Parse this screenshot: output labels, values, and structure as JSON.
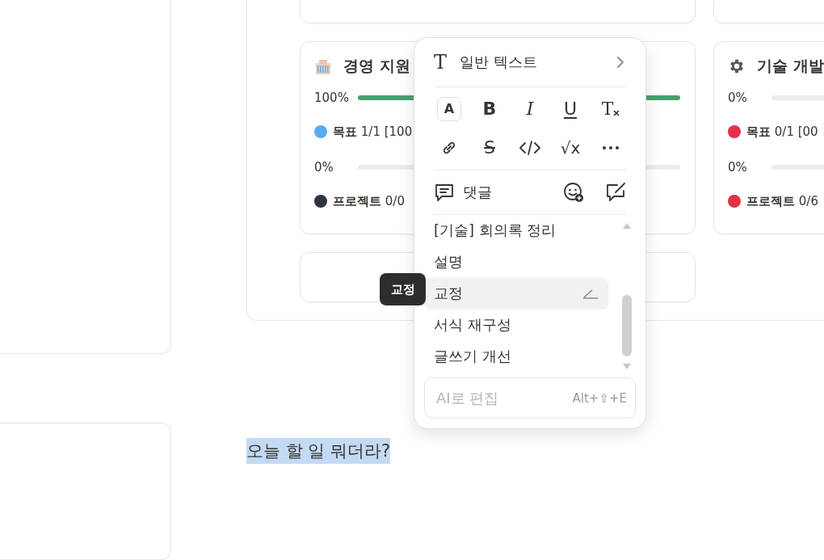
{
  "board": {
    "cards": [
      {
        "kind": "blank"
      },
      {
        "kind": "blank"
      },
      {
        "kind": "building",
        "title": "경영 지원",
        "rows": [
          {
            "kind": "progress",
            "reading": "100%",
            "level": 1
          },
          {
            "kind": "count",
            "label": "목표",
            "value": "1/1 [100",
            "color": "#5aabf0"
          },
          {
            "kind": "progress",
            "reading": "0%",
            "level": 0
          },
          {
            "kind": "count",
            "label": "프로젝트",
            "value": "0/0",
            "color": "#2e3440"
          }
        ]
      },
      {
        "kind": "gear",
        "title": "기술 개발",
        "rows": [
          {
            "kind": "progress",
            "reading": "0%",
            "level": 0
          },
          {
            "kind": "count",
            "label": "목표",
            "value": "0/1 [00",
            "color": "#e0334a"
          },
          {
            "kind": "progress",
            "reading": "0%",
            "level": 0
          },
          {
            "kind": "count",
            "label": "프로젝트",
            "value": "0/6",
            "color": "#e0334a"
          }
        ]
      },
      {
        "kind": "blank"
      }
    ]
  },
  "selected_text": "오늘 할 일 뭐더라?",
  "popup": {
    "block_type": {
      "icon_label": "T",
      "label": "일반 텍스트"
    },
    "format_buttons": [
      {
        "kind": "color",
        "label": "A"
      },
      {
        "kind": "bold",
        "label": "B"
      },
      {
        "kind": "italic",
        "label": "I"
      },
      {
        "kind": "underline",
        "label": "U"
      },
      {
        "kind": "clear",
        "label": "T"
      },
      {
        "kind": "link"
      },
      {
        "kind": "strike",
        "label": "S"
      },
      {
        "kind": "code"
      },
      {
        "kind": "math",
        "label": "√x"
      },
      {
        "kind": "more"
      }
    ],
    "comment_label": "댓글",
    "ai_items": [
      {
        "label": "[기술] 회의록 정리",
        "selected": false
      },
      {
        "label": "설명",
        "selected": false
      },
      {
        "label": "교정",
        "selected": true
      },
      {
        "label": "서식 재구성",
        "selected": false
      },
      {
        "label": "글쓰기 개선",
        "selected": false
      }
    ],
    "ai_input": {
      "placeholder": "AI로 편집",
      "shortcut": "Alt+⇧+E"
    }
  },
  "tooltip": "교정"
}
